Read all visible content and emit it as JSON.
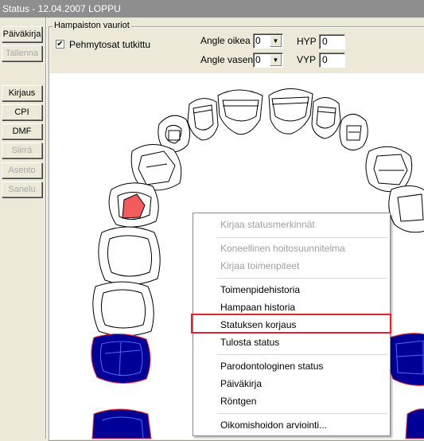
{
  "window": {
    "title": "Status - 12.04.2007   LOPPU"
  },
  "side_buttons": [
    {
      "label": "Päiväkirja",
      "enabled": true
    },
    {
      "label": "Tallenna",
      "enabled": false
    },
    {
      "label": "Kirjaus",
      "enabled": true
    },
    {
      "label": "CPI",
      "enabled": true
    },
    {
      "label": "DMF",
      "enabled": true
    },
    {
      "label": "Siirrä",
      "enabled": false
    },
    {
      "label": "Asento",
      "enabled": false
    },
    {
      "label": "Sanelu",
      "enabled": false
    }
  ],
  "group": {
    "legend": "Hampaiston vauriot"
  },
  "soft_tissue": {
    "label": "Pehmytosat tutkittu",
    "checked": true,
    "check_glyph": "✔"
  },
  "angles": {
    "right_label": "Angle oikea",
    "right_value": "0",
    "left_label": "Angle vasen",
    "left_value": "0",
    "dropdown_glyph": "▼"
  },
  "hyp": {
    "label": "HYP",
    "value": "0"
  },
  "vyp": {
    "label": "VYP",
    "value": "0"
  },
  "tooth_colors": {
    "outline": "#000000",
    "caries": "#f25c5c",
    "filled": "#000096",
    "filled_edge": "#ff3030"
  },
  "context_menu": {
    "items": [
      {
        "label": "Kirjaa statusmerkinnät",
        "enabled": false
      },
      {
        "label": "Koneellinen hoitosuunnitelma",
        "enabled": false
      },
      {
        "label": "Kirjaa toimenpiteet",
        "enabled": false
      },
      {
        "label": "Toimenpidehistoria",
        "enabled": true
      },
      {
        "label": "Hampaan historia",
        "enabled": true
      },
      {
        "label": "Statuksen korjaus",
        "enabled": true
      },
      {
        "label": "Tulosta status",
        "enabled": true
      },
      {
        "label": "Parodontologinen status",
        "enabled": true
      },
      {
        "label": "Päiväkirja",
        "enabled": true
      },
      {
        "label": "Röntgen",
        "enabled": true
      },
      {
        "label": "Oikomishoidon arviointi...",
        "enabled": true
      }
    ],
    "highlighted": "Statuksen korjaus",
    "highlight_color": "#e0242f"
  }
}
